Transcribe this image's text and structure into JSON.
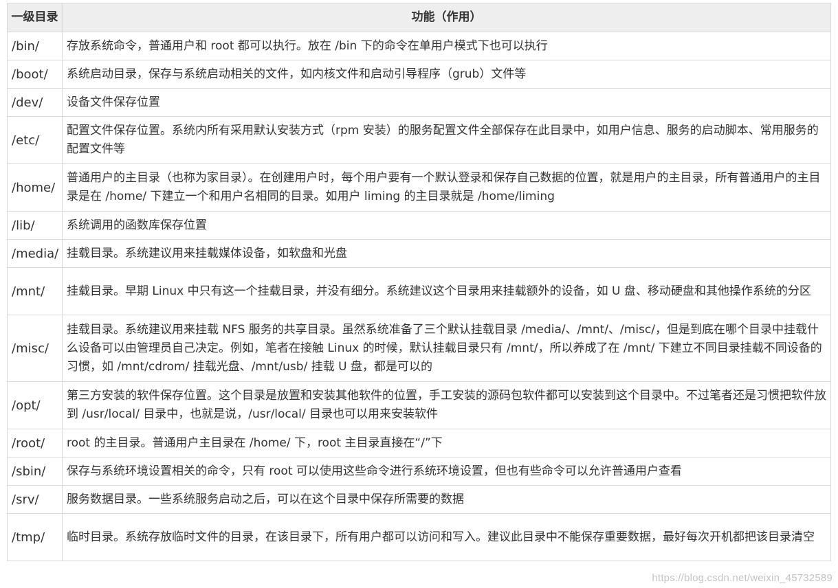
{
  "table": {
    "headers": [
      "一级目录",
      "功能（作用）"
    ],
    "rows": [
      {
        "dir": "/bin/",
        "desc": "存放系统命令，普通用户和 root 都可以执行。放在 /bin 下的命令在单用户模式下也可以执行"
      },
      {
        "dir": "/boot/",
        "desc": "系统启动目录，保存与系统启动相关的文件，如内核文件和启动引导程序（grub）文件等"
      },
      {
        "dir": "/dev/",
        "desc": "设备文件保存位置"
      },
      {
        "dir": "/etc/",
        "desc": "配置文件保存位置。系统内所有采用默认安装方式（rpm 安装）的服务配置文件全部保存在此目录中，如用户信息、服务的启动脚本、常用服务的配置文件等"
      },
      {
        "dir": "/home/",
        "desc": "普通用户的主目录（也称为家目录）。在创建用户时，每个用户要有一个默认登录和保存自己数据的位置，就是用户的主目录，所有普通用户的主目录是在 /home/ 下建立一个和用户名相同的目录。如用户 liming 的主目录就是 /home/liming"
      },
      {
        "dir": "/lib/",
        "desc": "系统调用的函数库保存位置"
      },
      {
        "dir": "/media/",
        "desc": "挂载目录。系统建议用来挂载媒体设备，如软盘和光盘"
      },
      {
        "dir": "/mnt/",
        "desc": "挂载目录。早期 Linux 中只有这一个挂载目录，并没有细分。系统建议这个目录用来挂载额外的设备，如 U 盘、移动硬盘和其他操作系统的分区"
      },
      {
        "dir": "/misc/",
        "desc": "挂载目录。系统建议用来挂载 NFS 服务的共享目录。虽然系统准备了三个默认挂载目录 /media/、/mnt/、/misc/，但是到底在哪个目录中挂载什么设备可以由管理员自己决定。例如，笔者在接触 Linux 的时候，默认挂载目录只有 /mnt/，所以养成了在 /mnt/ 下建立不同目录挂载不同设备的习惯，如 /mnt/cdrom/ 挂载光盘、/mnt/usb/ 挂载 U 盘，都是可以的"
      },
      {
        "dir": "/opt/",
        "desc": "第三方安装的软件保存位置。这个目录是放置和安装其他软件的位置，手工安装的源码包软件都可以安装到这个目录中。不过笔者还是习惯把软件放到 /usr/local/ 目录中，也就是说，/usr/local/ 目录也可以用来安装软件"
      },
      {
        "dir": "/root/",
        "desc": "root 的主目录。普通用户主目录在 /home/ 下，root 主目录直接在“/”下"
      },
      {
        "dir": "/sbin/",
        "desc": "保存与系统环境设置相关的命令，只有 root 可以使用这些命令进行系统环境设置，但也有些命令可以允许普通用户查看"
      },
      {
        "dir": "/srv/",
        "desc": "服务数据目录。一些系统服务启动之后，可以在这个目录中保存所需要的数据"
      },
      {
        "dir": "/tmp/",
        "desc": "临时目录。系统存放临时文件的目录，在该目录下，所有用户都可以访问和写入。建议此目录中不能保存重要数据，最好每次开机都把该目录清空"
      }
    ]
  },
  "watermark": "https://blog.csdn.net/weixin_45732589"
}
